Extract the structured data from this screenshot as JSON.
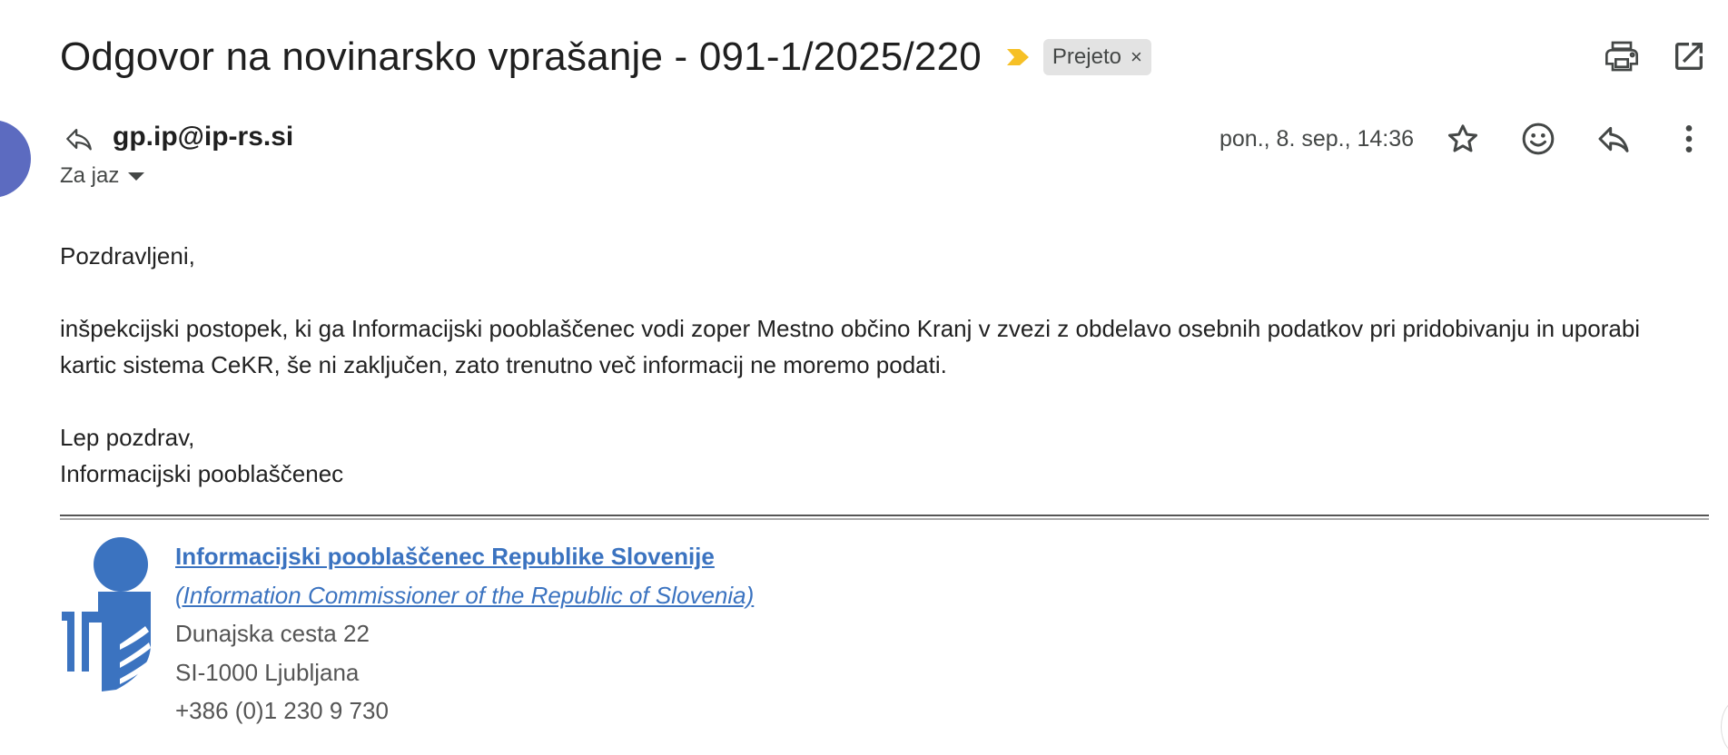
{
  "email": {
    "subject": "Odgovor na novinarsko vprašanje - 091-1/2025/220",
    "label": "Prejeto",
    "label_remove": "×",
    "sender": "gp.ip@ip-rs.si",
    "recipient": "Za jaz",
    "date": "pon., 8. sep., 14:36",
    "body": {
      "greeting": "Pozdravljeni,",
      "line1": "inšpekcijski postopek, ki ga Informacijski pooblaščenec vodi zoper Mestno občino Kranj v zvezi z obdelavo osebnih podatkov pri pridobivanju in uporabi",
      "line2": "kartic sistema CeKR, še ni zaključen, zato trenutno več informacij ne moremo podati.",
      "closing": "Lep pozdrav,",
      "signoff": "Informacijski pooblaščenec"
    },
    "signature": {
      "org_name": "Informacijski pooblaščenec Republike Slovenije",
      "org_name_en": "(Information Commissioner of the Republic of Slovenia)",
      "street": "Dunajska cesta 22",
      "city": "SI-1000 Ljubljana",
      "phone": "+386 (0)1 230 9 730"
    }
  },
  "icons": {
    "importance": "importance-marker-icon",
    "print": "print-icon",
    "open_new_window": "open-in-new-window-icon",
    "reply_indicator": "reply-icon",
    "star": "star-icon",
    "emoji": "emoji-reaction-icon",
    "reply": "reply-icon",
    "more": "more-vert-icon",
    "logo": "ip-logo"
  },
  "colors": {
    "importance": "#f6c026",
    "avatar": "#5c6bc0",
    "link": "#3b73c0",
    "label_bg": "#e3e3e3"
  }
}
